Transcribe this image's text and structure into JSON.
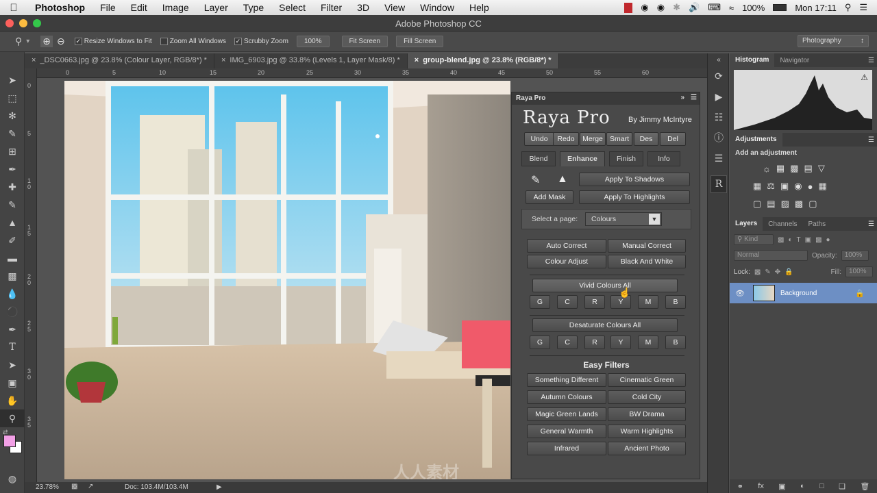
{
  "menubar": {
    "apple": "",
    "items": [
      "Photoshop",
      "File",
      "Edit",
      "Image",
      "Layer",
      "Type",
      "Select",
      "Filter",
      "3D",
      "View",
      "Window",
      "Help"
    ],
    "battery": "100%",
    "clock": "Mon 17:11"
  },
  "window": {
    "title": "Adobe Photoshop CC"
  },
  "options": {
    "resize": "Resize Windows to Fit",
    "zoom_all": "Zoom All Windows",
    "scrubby": "Scrubby Zoom",
    "percent": "100%",
    "fit_screen": "Fit Screen",
    "fill_screen": "Fill Screen",
    "workspace": "Photography"
  },
  "tabs": [
    {
      "label": "_DSC0663.jpg @ 23.8% (Colour Layer, RGB/8*) *"
    },
    {
      "label": "IMG_6903.jpg @ 33.8% (Levels 1, Layer Mask/8) *"
    },
    {
      "label": "group-blend.jpg @ 23.8% (RGB/8*) *"
    }
  ],
  "ruler_h": [
    "0",
    "5",
    "10",
    "15",
    "20",
    "25",
    "30",
    "35",
    "40",
    "45",
    "50",
    "55",
    "60"
  ],
  "ruler_v": [
    "0",
    "5",
    "1 0",
    "1 5",
    "2 0",
    "2 5",
    "3 0",
    "3 5"
  ],
  "status": {
    "zoom": "23.78%",
    "doc": "Doc: 103.4M/103.4M"
  },
  "raya": {
    "header": "Raya Pro",
    "logo": "Raya Pro",
    "byline": "By Jimmy McIntyre",
    "top_buttons": [
      "Undo",
      "Redo",
      "Merge",
      "Smart",
      "Des",
      "Del"
    ],
    "tabs": [
      "Blend",
      "Enhance",
      "Finish",
      "Info"
    ],
    "apply_shadows": "Apply To Shadows",
    "add_mask": "Add Mask",
    "apply_highlights": "Apply To Highlights",
    "select_page_label": "Select a page:",
    "select_page_value": "Colours",
    "auto_correct": "Auto Correct",
    "manual_correct": "Manual Correct",
    "colour_adjust": "Colour Adjust",
    "black_white": "Black And White",
    "vivid_all": "Vivid Colours All",
    "vivid_letters": [
      "G",
      "C",
      "R",
      "Y",
      "M",
      "B"
    ],
    "desat_all": "Desaturate Colours All",
    "desat_letters": [
      "G",
      "C",
      "R",
      "Y",
      "M",
      "B"
    ],
    "easy_title": "Easy Filters",
    "filters": [
      "Something Different",
      "Cinematic Green",
      "Autumn Colours",
      "Cold City",
      "Magic Green Lands",
      "BW Drama",
      "General Warmth",
      "Warm Highlights",
      "Infrared",
      "Ancient Photo"
    ]
  },
  "panels": {
    "histogram_tab": "Histogram",
    "navigator_tab": "Navigator",
    "adjustments_tab": "Adjustments",
    "add_adjustment": "Add an adjustment",
    "layers_tab": "Layers",
    "channels_tab": "Channels",
    "paths_tab": "Paths",
    "kind": "Kind",
    "blend_mode": "Normal",
    "opacity_label": "Opacity:",
    "opacity_value": "100%",
    "lock_label": "Lock:",
    "fill_label": "Fill:",
    "fill_value": "100%",
    "layer_name": "Background"
  },
  "watermark": "人人素材",
  "colors": {
    "foreground": "#f2a0e6",
    "background": "#ffffff",
    "accent": "#6d8fc4"
  }
}
